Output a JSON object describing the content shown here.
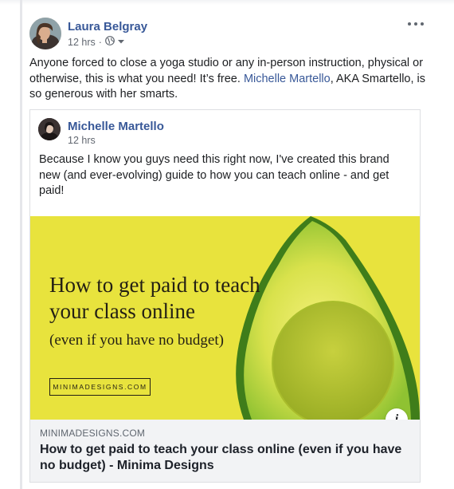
{
  "post": {
    "author": "Laura Belgray",
    "time": "12 hrs",
    "separator": "·",
    "text_before": "Anyone forced to close a yoga studio or any in-person instruction, physical or otherwise, this is what you need! It’s free. ",
    "mention": "Michelle Martello",
    "text_after": ", AKA Smartello, is so generous with her smarts."
  },
  "shared": {
    "author": "Michelle Martello",
    "time": "12 hrs",
    "text": "Because I know you guys need this right now, I've created this brand new (and ever-evolving) guide to how you can teach online - and get paid!",
    "image": {
      "headline_line1": "How to get paid to teach",
      "headline_line2": "your class online",
      "subhead": "(even if you have no budget)",
      "brand": "MINIMADESIGNS.COM",
      "background_color": "#e8e33d"
    },
    "link": {
      "domain": "MINIMADESIGNS.COM",
      "title": "How to get paid to teach your class online (even if you have no budget) - Minima Designs"
    }
  },
  "icons": {
    "privacy": "globe-icon",
    "audience_menu": "caret-down-icon",
    "options": "more-options-icon",
    "info": "info-icon"
  }
}
